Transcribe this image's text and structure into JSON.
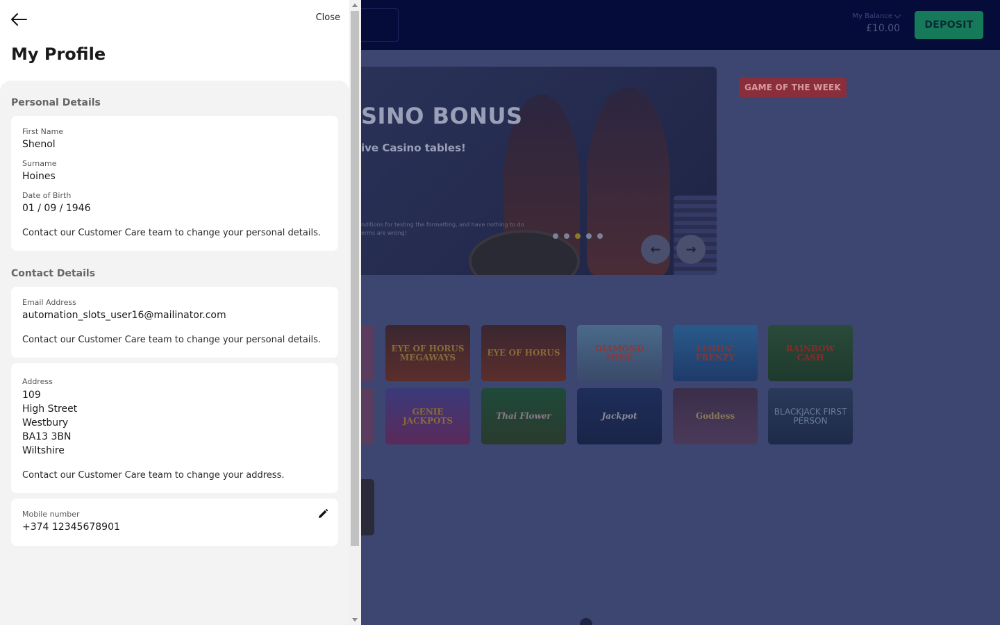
{
  "header": {
    "balance_label": "My Balance",
    "balance_amount": "£10.00",
    "deposit_label": "DEPOSIT"
  },
  "banner": {
    "title": "SINO BONUS",
    "subtitle": "ive Casino tables!",
    "fine_print": "nditions for testing the formatting, and have nothing to do erms are wrong!",
    "dots_total": 5,
    "dots_active_index": 2
  },
  "game_of_week": {
    "label": "GAME OF THE WEEK"
  },
  "games": {
    "row1": [
      "EYE OF HORUS MEGAWAYS",
      "EYE OF HORUS",
      "DIAMOND MINE",
      "FISHIN' FRENZY",
      "RAINBOW CASH"
    ],
    "row2": [
      "GENIE JACKPOTS",
      "Thai Flower",
      "Jackpot",
      "Goddess",
      "BLACKJACK FIRST PERSON"
    ]
  },
  "drawer": {
    "close_label": "Close",
    "title": "My Profile",
    "personal": {
      "heading": "Personal Details",
      "first_name_label": "First Name",
      "first_name": "Shenol",
      "surname_label": "Surname",
      "surname": "Hoines",
      "dob_label": "Date of Birth",
      "dob": "01 / 09 / 1946",
      "note": "Contact our Customer Care team to change your personal details."
    },
    "contact": {
      "heading": "Contact Details",
      "email_label": "Email Address",
      "email": "automation_slots_user16@mailinator.com",
      "email_note": "Contact our Customer Care team to change your personal details.",
      "address_label": "Address",
      "address_lines": [
        "109",
        "High Street",
        "Westbury",
        "BA13 3BN",
        "Wiltshire"
      ],
      "address_note": "Contact our Customer Care team to change your address.",
      "mobile_label": "Mobile number",
      "mobile": "+374 12345678901"
    }
  },
  "colors": {
    "topbar": "#050c3a",
    "deposit": "#167a5a",
    "gotw": "#8a2e3c",
    "drawer_bg": "#f3f3f3"
  }
}
